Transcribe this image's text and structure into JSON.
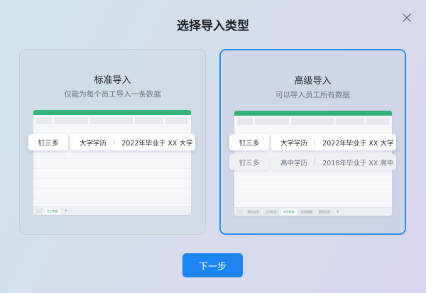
{
  "dialog": {
    "title": "选择导入类型",
    "next_label": "下一步"
  },
  "standard": {
    "title": "标准导入",
    "subtitle": "仅能为每个员工导入一条数据",
    "rows": [
      {
        "name": "钉三多",
        "degree": "大学学历",
        "detail": "2022年毕业于 XX 大学"
      }
    ],
    "tabs": [
      "···",
      "员工数据"
    ],
    "active_tab": 1
  },
  "advanced": {
    "title": "高级导入",
    "subtitle": "可以导入员工所有数据",
    "rows": [
      {
        "name": "钉三多",
        "degree": "大学学历",
        "detail": "2022年毕业于 XX 大学"
      },
      {
        "name": "钉三多",
        "degree": "高中学历",
        "detail": "2018年毕业于 XX 高中"
      }
    ],
    "tabs": [
      "···",
      "基本信息",
      "工作信息",
      "学历数据",
      "合同数据",
      "薪资信息"
    ],
    "active_tab": 3
  },
  "icons": {
    "close": "close-icon",
    "add_sheet": "plus-icon"
  },
  "colors": {
    "primary": "#1c85f2",
    "selected_border": "#2b8ef5",
    "sheet_header": "#35b27a"
  }
}
